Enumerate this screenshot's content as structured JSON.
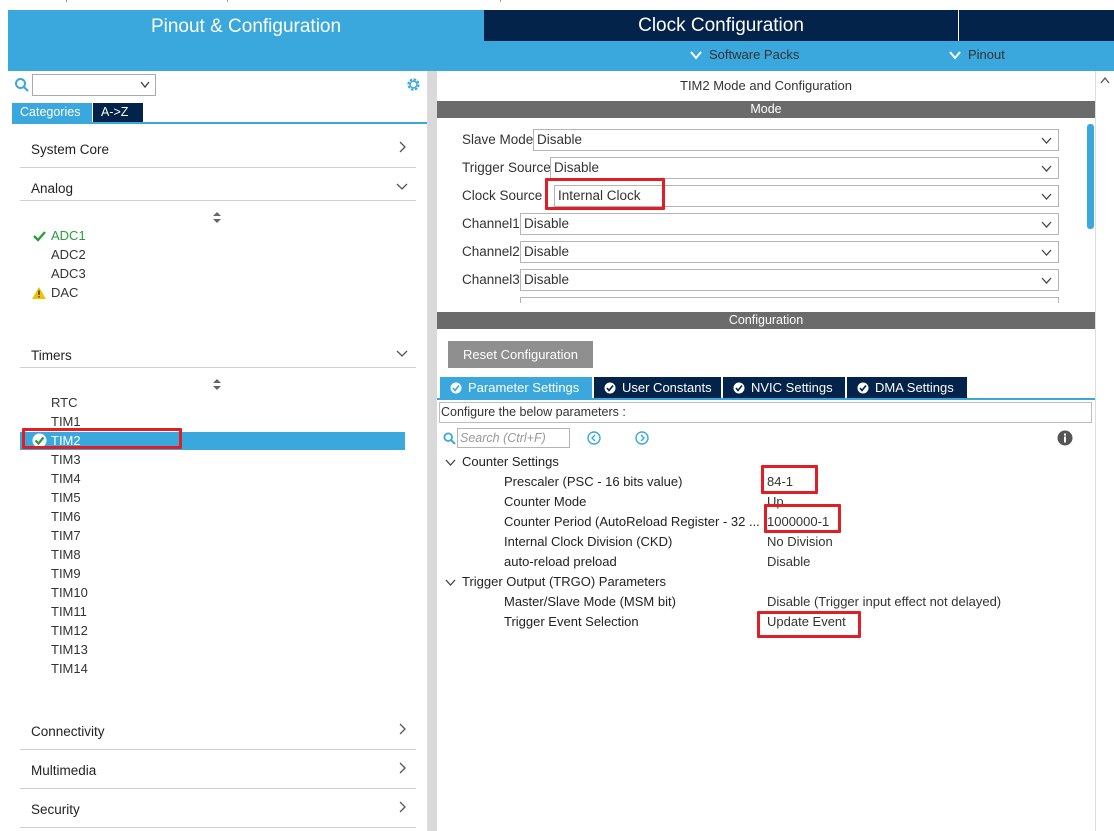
{
  "header": {
    "pinout_config_tab": "Pinout & Configuration",
    "clock_config_tab": "Clock Configuration",
    "software_packs": "Software Packs",
    "pinout": "Pinout"
  },
  "sidebar": {
    "search_value": "",
    "tabs": [
      "Categories",
      "A->Z"
    ],
    "sections": {
      "system_core": "System Core",
      "analog": "Analog",
      "timers": "Timers",
      "connectivity": "Connectivity",
      "multimedia": "Multimedia",
      "security": "Security"
    },
    "analog_items": [
      "ADC1",
      "ADC2",
      "ADC3",
      "DAC"
    ],
    "timer_items": [
      "RTC",
      "TIM1",
      "TIM2",
      "TIM3",
      "TIM4",
      "TIM5",
      "TIM6",
      "TIM7",
      "TIM8",
      "TIM9",
      "TIM10",
      "TIM11",
      "TIM12",
      "TIM13",
      "TIM14"
    ],
    "selected_item": "TIM2"
  },
  "main": {
    "title": "TIM2 Mode and Configuration",
    "mode_header": "Mode",
    "config_header": "Configuration",
    "mode_rows": [
      {
        "label": "Slave Mode",
        "value": "Disable"
      },
      {
        "label": "Trigger Source",
        "value": "Disable"
      },
      {
        "label": "Clock Source",
        "value": "Internal Clock"
      },
      {
        "label": "Channel1",
        "value": "Disable"
      },
      {
        "label": "Channel2",
        "value": "Disable"
      },
      {
        "label": "Channel3",
        "value": "Disable"
      }
    ],
    "reset_button": "Reset Configuration",
    "tabs": [
      "Parameter Settings",
      "User Constants",
      "NVIC Settings",
      "DMA Settings"
    ],
    "configure_text": "Configure the below parameters :",
    "search_placeholder": "Search (Ctrl+F)",
    "groups": [
      {
        "name": "Counter Settings",
        "params": [
          {
            "label": "Prescaler (PSC - 16 bits value)",
            "value": "84-1"
          },
          {
            "label": "Counter Mode",
            "value": "Up"
          },
          {
            "label": "Counter Period (AutoReload Register - 32 ...",
            "value": "1000000-1"
          },
          {
            "label": "Internal Clock Division (CKD)",
            "value": "No Division"
          },
          {
            "label": "auto-reload preload",
            "value": "Disable"
          }
        ]
      },
      {
        "name": "Trigger Output (TRGO) Parameters",
        "params": [
          {
            "label": "Master/Slave Mode (MSM bit)",
            "value": "Disable (Trigger input effect not delayed)"
          },
          {
            "label": "Trigger Event Selection",
            "value": "Update Event"
          }
        ]
      }
    ]
  },
  "colors": {
    "accent_blue": "#3aa8dc",
    "dark_navy": "#03234b",
    "highlight_red": "#e01e26",
    "ok_green": "#2a9d3c",
    "warn_yellow": "#f2c200"
  }
}
